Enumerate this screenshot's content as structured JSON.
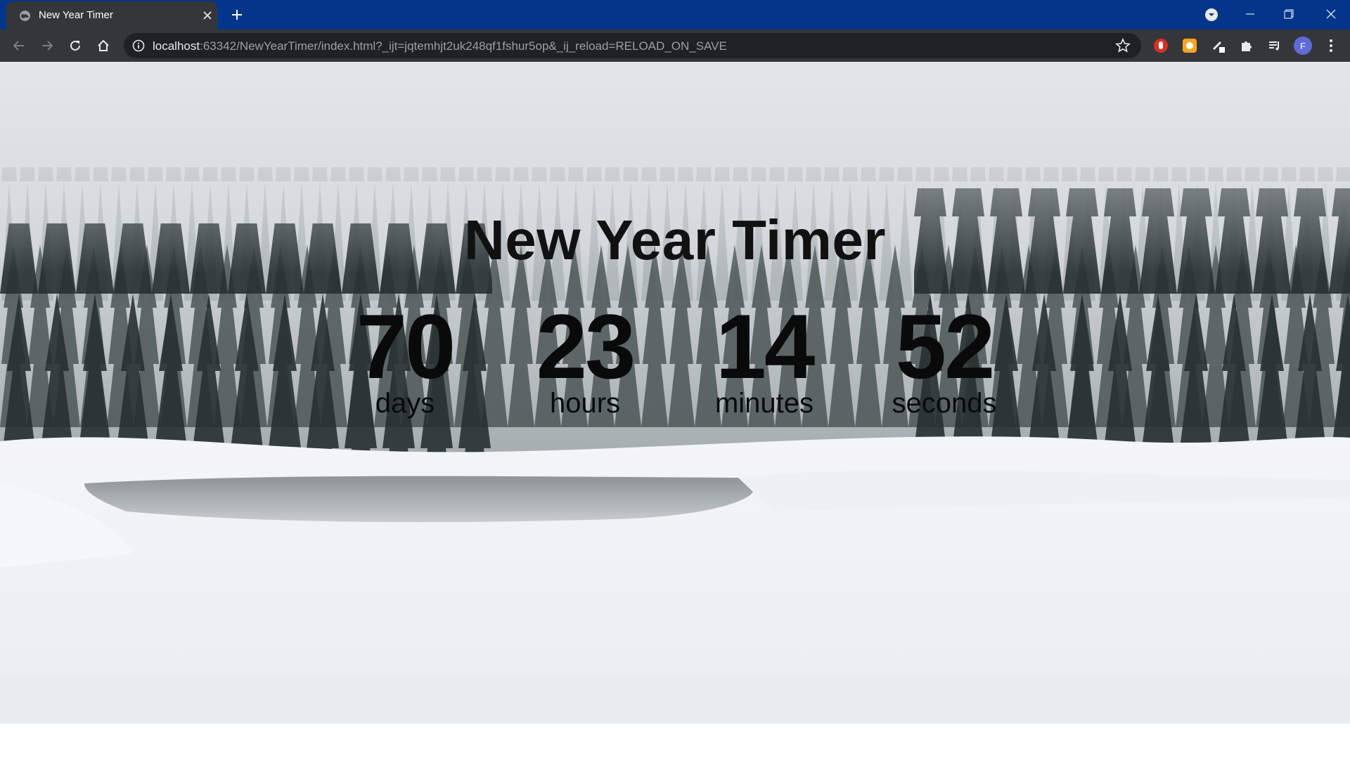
{
  "browser": {
    "tab": {
      "title": "New Year Timer"
    },
    "address_bar": {
      "host": "localhost",
      "rest": ":63342/NewYearTimer/index.html?_ijt=jqtemhjt2uk248qf1fshur5op&_ij_reload=RELOAD_ON_SAVE"
    },
    "profile_initial": "F"
  },
  "page": {
    "title": "New Year Timer",
    "countdown": [
      {
        "value": "70",
        "unit": "days"
      },
      {
        "value": "23",
        "unit": "hours"
      },
      {
        "value": "14",
        "unit": "minutes"
      },
      {
        "value": "52",
        "unit": "seconds"
      }
    ]
  },
  "colors": {
    "tabstrip": "#03368a",
    "toolbar": "#35363a",
    "omnibox": "#202124",
    "avatar": "#5f6bd6"
  }
}
